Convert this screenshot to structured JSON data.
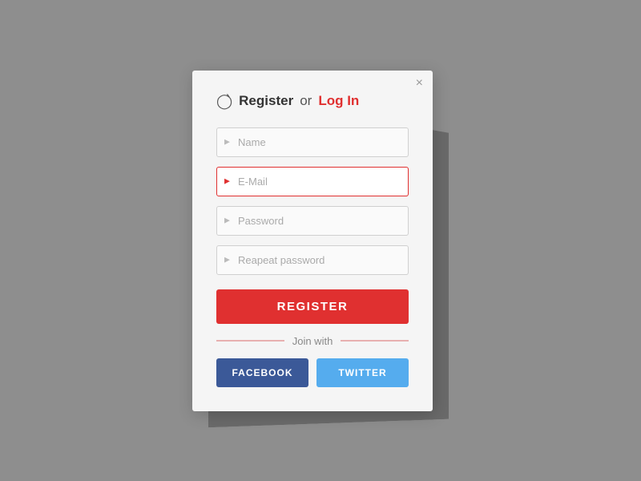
{
  "modal": {
    "title": {
      "register_text": "Register",
      "or_text": "or",
      "login_text": "Log In"
    },
    "close_button": "×",
    "fields": {
      "name": {
        "placeholder": "Name"
      },
      "email": {
        "placeholder": "E-Mail",
        "active": true
      },
      "password": {
        "placeholder": "Password"
      },
      "repeat_password": {
        "placeholder": "Reapeat password"
      }
    },
    "register_button": "REGISTER",
    "join_with": {
      "label": "Join with",
      "facebook_button": "FACEBOOK",
      "twitter_button": "TWITTER"
    }
  }
}
